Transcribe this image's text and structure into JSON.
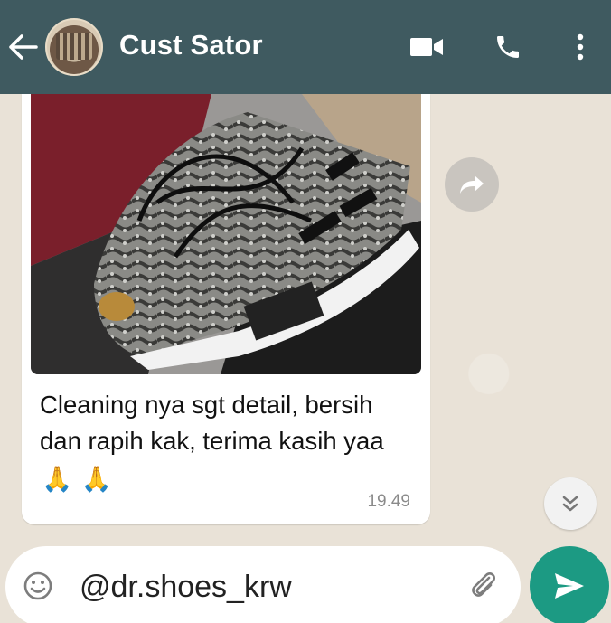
{
  "header": {
    "contact_name": "Cust Sator",
    "color": "#3f5a60"
  },
  "message": {
    "caption": "Cleaning nya sgt detail, bersih dan rapih kak, terima kasih yaa",
    "emojis": [
      "🙏",
      "🙏"
    ],
    "time": "19.49"
  },
  "composer": {
    "value": "@dr.shoes_krw",
    "send_color": "#1c9a83"
  },
  "icons": {
    "back": "arrow-left-icon",
    "video": "video-camera-icon",
    "call": "phone-icon",
    "menu": "vertical-dots-icon",
    "forward": "share-forward-icon",
    "scroll": "double-chevron-down-icon",
    "emoji": "smiley-icon",
    "attach": "paperclip-icon",
    "send": "send-icon"
  }
}
